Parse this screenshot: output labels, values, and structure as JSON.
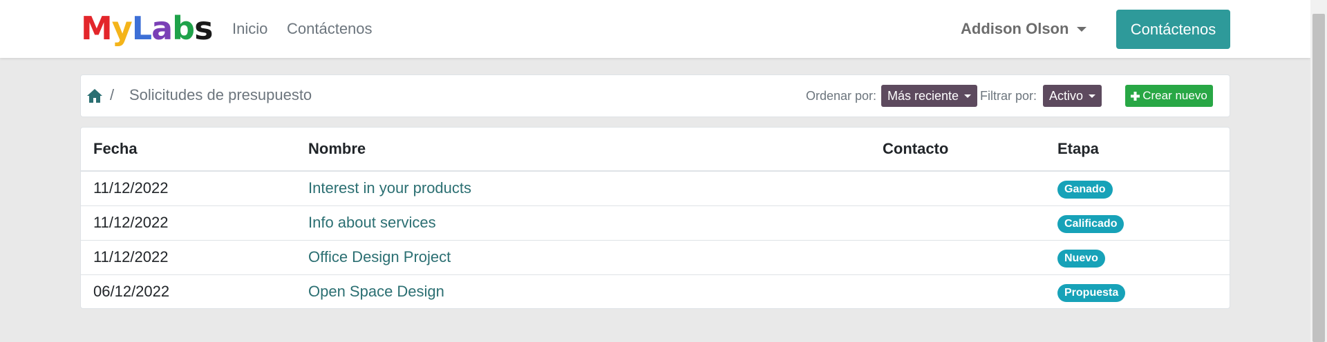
{
  "brand": {
    "letters": [
      {
        "ch": "M",
        "color": "#e3262b"
      },
      {
        "ch": "y",
        "color": "#f4b41a"
      },
      {
        "ch": "L",
        "color": "#3d6fd6"
      },
      {
        "ch": "a",
        "color": "#7a3fb6"
      },
      {
        "ch": "b",
        "color": "#1fa24a"
      },
      {
        "ch": "s",
        "color": "#1a1a1a"
      }
    ]
  },
  "nav": {
    "links": [
      "Inicio",
      "Contáctenos"
    ],
    "user": "Addison Olson",
    "cta": "Contáctenos"
  },
  "breadcrumb": {
    "separator": "/",
    "title": "Solicitudes de presupuesto"
  },
  "toolbar": {
    "sort_label": "Ordenar por:",
    "sort_value": "Más reciente",
    "filter_label": "Filtrar por:",
    "filter_value": "Activo",
    "create_label": "Crear nuevo"
  },
  "table": {
    "headers": [
      "Fecha",
      "Nombre",
      "Contacto",
      "Etapa"
    ],
    "rows": [
      {
        "date": "11/12/2022",
        "name": "Interest in your products",
        "contact": "",
        "stage": "Ganado"
      },
      {
        "date": "11/12/2022",
        "name": "Info about services",
        "contact": "",
        "stage": "Calificado"
      },
      {
        "date": "11/12/2022",
        "name": "Office Design Project",
        "contact": "",
        "stage": "Nuevo"
      },
      {
        "date": "06/12/2022",
        "name": "Open Space Design",
        "contact": "",
        "stage": "Propuesta"
      }
    ]
  },
  "colors": {
    "primary": "#2e9a9a",
    "link": "#2b6f72",
    "dropdown_bg": "#5d4a5e",
    "success": "#28a745",
    "badge": "#17a2b8",
    "home_icon": "#2b6f72"
  },
  "icons": {
    "home": "home-icon",
    "plus": "plus-icon",
    "caret": "caret-down-icon"
  }
}
